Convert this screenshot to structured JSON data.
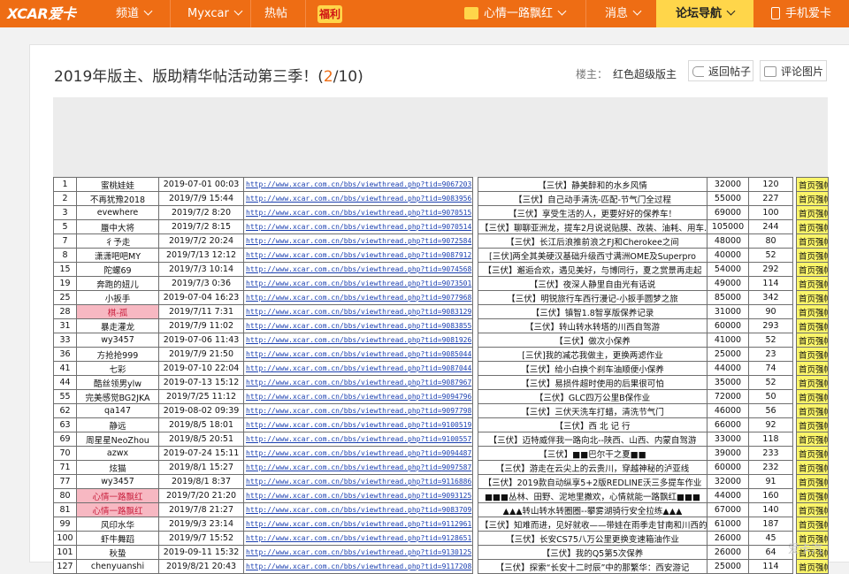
{
  "nav": {
    "logo": "XCAR爱卡",
    "channel": "频道",
    "myxcar": "Myxcar",
    "hot": "热帖",
    "fuli": "福利",
    "user": "心情一路飘红",
    "messages": "消息",
    "forum_nav": "论坛导航",
    "mobile": "手机爱卡",
    "accent": "#ee6d14"
  },
  "post": {
    "title": "2019年版主、版助精华帖活动第三季！(",
    "page_current": "2",
    "page_rest": "/10)",
    "author_label": "楼主：",
    "author": "红色超级版主",
    "back_button": "返回帖子",
    "comment_button": "评论图片"
  },
  "sheet": {
    "url_prefix": "http://www.xcar.com.cn/bbs/viewthread.php?tid=",
    "rows": [
      {
        "no": "1",
        "user": "蜜桃娃娃",
        "date": "2019-07-01 00:03",
        "tid": "9067203",
        "title": "【三伏】静美醉和的水乡风情",
        "views": "32000",
        "replies": "120",
        "tag": "首页强帖"
      },
      {
        "no": "2",
        "user": "不再犹豫2018",
        "date": "2019/7/9 15:44",
        "tid": "9083956",
        "title": "【三伏】自己动手清洗-匹配-节气门全过程",
        "views": "55000",
        "replies": "227",
        "tag": "首页强帖"
      },
      {
        "no": "3",
        "user": "evewhere",
        "date": "2019/7/2 8:20",
        "tid": "9070515",
        "title": "【三伏】享受生活的人，更要好好的保养车！",
        "views": "69000",
        "replies": "100",
        "tag": "首页强帖"
      },
      {
        "no": "5",
        "user": "蜃中大将",
        "date": "2019/7/2 8:15",
        "tid": "9070514",
        "title": "【三伏】聊聊亚洲龙，提车2月说说贴膜、改装、油耗、用车…",
        "views": "105000",
        "replies": "244",
        "tag": "首页强帖"
      },
      {
        "no": "7",
        "user": "彳予走",
        "date": "2019/7/2 20:24",
        "tid": "9072584",
        "title": "【三伏】长江后浪推前浪之FJ和Cherokee之间",
        "views": "48000",
        "replies": "80",
        "tag": "首页强帖"
      },
      {
        "no": "8",
        "user": "潇潇吧吧MY",
        "date": "2019/7/13 12:12",
        "tid": "9087912",
        "title": "[三伏]两全其美硬汉基础升级西寸满洲OME及Superpro",
        "views": "40000",
        "replies": "52",
        "tag": "首页强帖"
      },
      {
        "no": "15",
        "user": "陀螺69",
        "date": "2019/7/3 10:14",
        "tid": "9074568",
        "title": "【三伏】邂逅合欢，遇见美好，与博同行，夏之赏景再走起",
        "views": "54000",
        "replies": "292",
        "tag": "首页强帖"
      },
      {
        "no": "19",
        "user": "奔跑的妞儿",
        "date": "2019/7/3 0:36",
        "tid": "9073501",
        "title": "【三伏】夜深人静里自由光有话说",
        "views": "49000",
        "replies": "114",
        "tag": "首页强帖"
      },
      {
        "no": "25",
        "user": "小扳手",
        "date": "2019-07-04 16:23",
        "tid": "9077968",
        "title": "【三伏】明锐旅行车西行漫记-小扳手圆梦之旅",
        "views": "85000",
        "replies": "342",
        "tag": "首页强帖"
      },
      {
        "no": "28",
        "user": "棋-孤",
        "date": "2019/7/11 7:31",
        "tid": "9083129",
        "title": "【三伏】镇智1.8智享版保养记录",
        "views": "31000",
        "replies": "90",
        "tag": "首页强帖",
        "pink": true
      },
      {
        "no": "31",
        "user": "暴走灌龙",
        "date": "2019/7/9 11:02",
        "tid": "9083855",
        "title": "【三伏】转山转水转塔的川西自驾游",
        "views": "60000",
        "replies": "293",
        "tag": "首页强帖"
      },
      {
        "no": "33",
        "user": "wy3457",
        "date": "2019-07-06 11:43",
        "tid": "9081926",
        "title": "【三伏】做次小保养",
        "views": "41000",
        "replies": "52",
        "tag": "首页强帖"
      },
      {
        "no": "36",
        "user": "方抢抢999",
        "date": "2019/7/9 21:50",
        "tid": "9085044",
        "title": "[三伏]我的减芯我做主，更换两滤作业",
        "views": "25000",
        "replies": "23",
        "tag": "首页强帖"
      },
      {
        "no": "41",
        "user": "七彩",
        "date": "2019-07-10 22:04",
        "tid": "9087044",
        "title": "【三伏】给小白换个刹车油顺便小保养",
        "views": "44000",
        "replies": "74",
        "tag": "首页强帖"
      },
      {
        "no": "44",
        "user": "酷丝领男ylw",
        "date": "2019-07-13 15:12",
        "tid": "9087967",
        "title": "【三伏】易损件超时使用的后果很可怕",
        "views": "35000",
        "replies": "52",
        "tag": "首页强帖"
      },
      {
        "no": "55",
        "user": "完美感觉BG2JKA",
        "date": "2019/7/25 11:12",
        "tid": "9094796",
        "title": "【三伏】GLC四万公里B保作业",
        "views": "72000",
        "replies": "50",
        "tag": "首页强帖"
      },
      {
        "no": "62",
        "user": "qa147",
        "date": "2019-08-02 09:39",
        "tid": "9097798",
        "title": "【三伏】三伏天洗车打蜡，清洗节气门",
        "views": "46000",
        "replies": "56",
        "tag": "首页强帖"
      },
      {
        "no": "63",
        "user": "静远",
        "date": "2019/8/5 18:01",
        "tid": "9100519",
        "title": "【三伏】西 北 记 行",
        "views": "66000",
        "replies": "92",
        "tag": "首页强帖"
      },
      {
        "no": "69",
        "user": "周星星NeoZhou",
        "date": "2019/8/5 20:51",
        "tid": "9100557",
        "title": "【三伏】迈特威伴我一路向北--陕西、山西、内蒙自驾游",
        "views": "33000",
        "replies": "118",
        "tag": "首页强帖"
      },
      {
        "no": "70",
        "user": "azwx",
        "date": "2019-07-24 15:11",
        "tid": "9094487",
        "title": "【三伏】■■巴尔干之夏■■",
        "views": "39000",
        "replies": "233",
        "tag": "首页强帖"
      },
      {
        "no": "71",
        "user": "炫猫",
        "date": "2019/8/1 15:27",
        "tid": "9097587",
        "title": "【三伏】游走在云尖上的云贵川，穿越神秘的泸亚线",
        "views": "60000",
        "replies": "232",
        "tag": "首页强帖"
      },
      {
        "no": "77",
        "user": "wy3457",
        "date": "2019/8/1 8:37",
        "tid": "9116886",
        "title": "【三伏】2019款自动纵享5+2版REDLINE沃三多提车作业",
        "views": "32000",
        "replies": "91",
        "tag": "首页强帖"
      },
      {
        "no": "80",
        "user": "心情一路飘红",
        "date": "2019/7/20 21:20",
        "tid": "9093125",
        "title": "■■■丛林、田野、泥地里撒欢，心情就能一路飘红■■■",
        "views": "44000",
        "replies": "160",
        "tag": "首页强帖",
        "pink": true
      },
      {
        "no": "81",
        "user": "心情一路飘红",
        "date": "2019/7/8 21:27",
        "tid": "9083709",
        "title": "▲▲▲转山转水转圈圈--攀雾湖骑行安全拉练▲▲▲",
        "views": "67000",
        "replies": "140",
        "tag": "首页强帖",
        "pink": true
      },
      {
        "no": "99",
        "user": "风印水华",
        "date": "2019/9/3 23:14",
        "tid": "9112961",
        "title": "【三伏】知难而进，见好就收——带娃在雨季走甘南和川西的故",
        "views": "61000",
        "replies": "187",
        "tag": "首页强帖"
      },
      {
        "no": "100",
        "user": "虾牛舞蹈",
        "date": "2019/9/7 15:52",
        "tid": "9128651",
        "title": "【三伏】长安CS75八万公里更换变速箱油作业",
        "views": "26000",
        "replies": "45",
        "tag": "首页强帖"
      },
      {
        "no": "101",
        "user": "秋蛰",
        "date": "2019-09-11 15:32",
        "tid": "9130125",
        "title": "【三伏】我的Q5第5次保养",
        "views": "26000",
        "replies": "64",
        "tag": "首页强帖"
      },
      {
        "no": "127",
        "user": "chenyuanshi",
        "date": "2019/8/21 20:43",
        "tid": "9117208",
        "title": "【三伏】探索“长安十二时辰”中的那繁华：西安游记",
        "views": "25000",
        "replies": "114",
        "tag": "首页强帖"
      }
    ]
  },
  "watermark": "爱卡汽"
}
